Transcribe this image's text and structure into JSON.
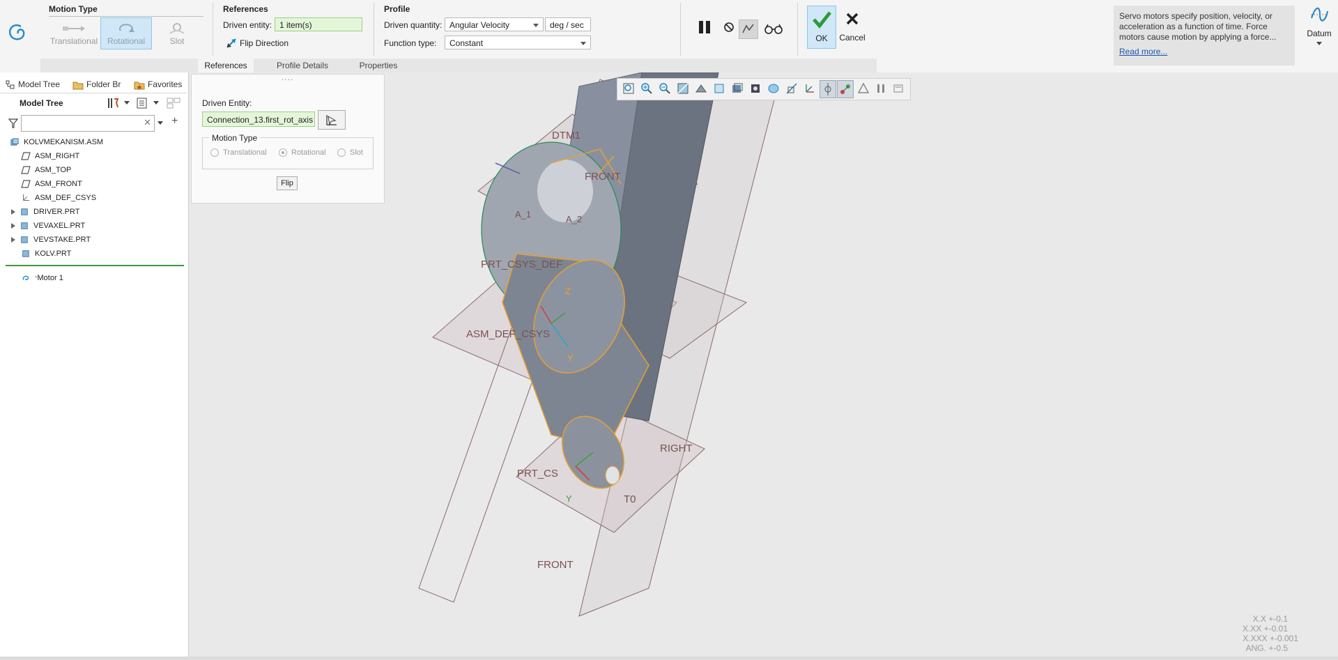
{
  "ribbon": {
    "motion_type": {
      "title": "Motion Type",
      "options": [
        {
          "label": "Translational",
          "state": "disabled"
        },
        {
          "label": "Rotational",
          "state": "selected"
        },
        {
          "label": "Slot",
          "state": "disabled"
        }
      ]
    },
    "references": {
      "title": "References",
      "driven_entity_label": "Driven entity:",
      "driven_entity_value": "1 item(s)",
      "flip_direction_label": "Flip Direction"
    },
    "profile": {
      "title": "Profile",
      "driven_quantity_label": "Driven quantity:",
      "driven_quantity_value": "Angular Velocity",
      "unit": "deg / sec",
      "function_type_label": "Function type:",
      "function_type_value": "Constant"
    },
    "ok_label": "OK",
    "cancel_label": "Cancel",
    "help_text": "Servo motors specify position, velocity, or acceleration as a function of time. Force motors cause motion by applying a force...",
    "read_more": "Read more...",
    "datum_label": "Datum",
    "subtabs": [
      "References",
      "Profile Details",
      "Properties"
    ]
  },
  "left_panel": {
    "tabs": [
      "Model Tree",
      "Folder Br",
      "Favorites"
    ],
    "title": "Model Tree",
    "search_value": "",
    "tree": [
      {
        "label": "KOLVMEKANISM.ASM",
        "icon": "assembly-icon",
        "expandable": false,
        "indent": 0
      },
      {
        "label": "ASM_RIGHT",
        "icon": "datum-plane-icon",
        "expandable": false,
        "indent": 1
      },
      {
        "label": "ASM_TOP",
        "icon": "datum-plane-icon",
        "expandable": false,
        "indent": 1
      },
      {
        "label": "ASM_FRONT",
        "icon": "datum-plane-icon",
        "expandable": false,
        "indent": 1
      },
      {
        "label": "ASM_DEF_CSYS",
        "icon": "csys-icon",
        "expandable": false,
        "indent": 1
      },
      {
        "label": "DRIVER.PRT",
        "icon": "part-icon",
        "expandable": true,
        "indent": 1
      },
      {
        "label": "VEVAXEL.PRT",
        "icon": "part-icon",
        "expandable": true,
        "indent": 1
      },
      {
        "label": "VEVSTAKE.PRT",
        "icon": "part-icon",
        "expandable": true,
        "indent": 1
      },
      {
        "label": "KOLV.PRT",
        "icon": "part-icon",
        "expandable": false,
        "indent": 1
      }
    ],
    "motor": "Motor 1"
  },
  "ref_panel": {
    "driven_entity_label": "Driven Entity:",
    "driven_entity_value": "Connection_13.first_rot_axis",
    "motion_type_title": "Motion Type",
    "options": [
      "Translational",
      "Rotational",
      "Slot"
    ],
    "selected_option": "Rotational",
    "flip_label": "Flip"
  },
  "viewport": {
    "labels": {
      "dtm1": "DTM1",
      "front_top": "FRONT",
      "prt_csys": "PRT_CSYS_DEF",
      "asm_def": "ASM_DEF_CSYS",
      "right": "RIGHT",
      "prt_cs": "PRT_CS",
      "t0": "T0",
      "front_bottom": "FRONT",
      "a1": "A_1",
      "a2": "A_2",
      "y1": "Y",
      "y2": "Y",
      "z": "Z"
    },
    "tolerances": [
      "X.X +-0.1",
      "X.XX +-0.01",
      "X.XXX +-0.001",
      "ANG. +-0.5"
    ]
  },
  "colors": {
    "accent": "#1a84c8",
    "selected_bg": "#cfe7f7",
    "green_field": "#e4f6d8",
    "part_edge": "#e8a030",
    "datum_plane": "#7a5050"
  }
}
